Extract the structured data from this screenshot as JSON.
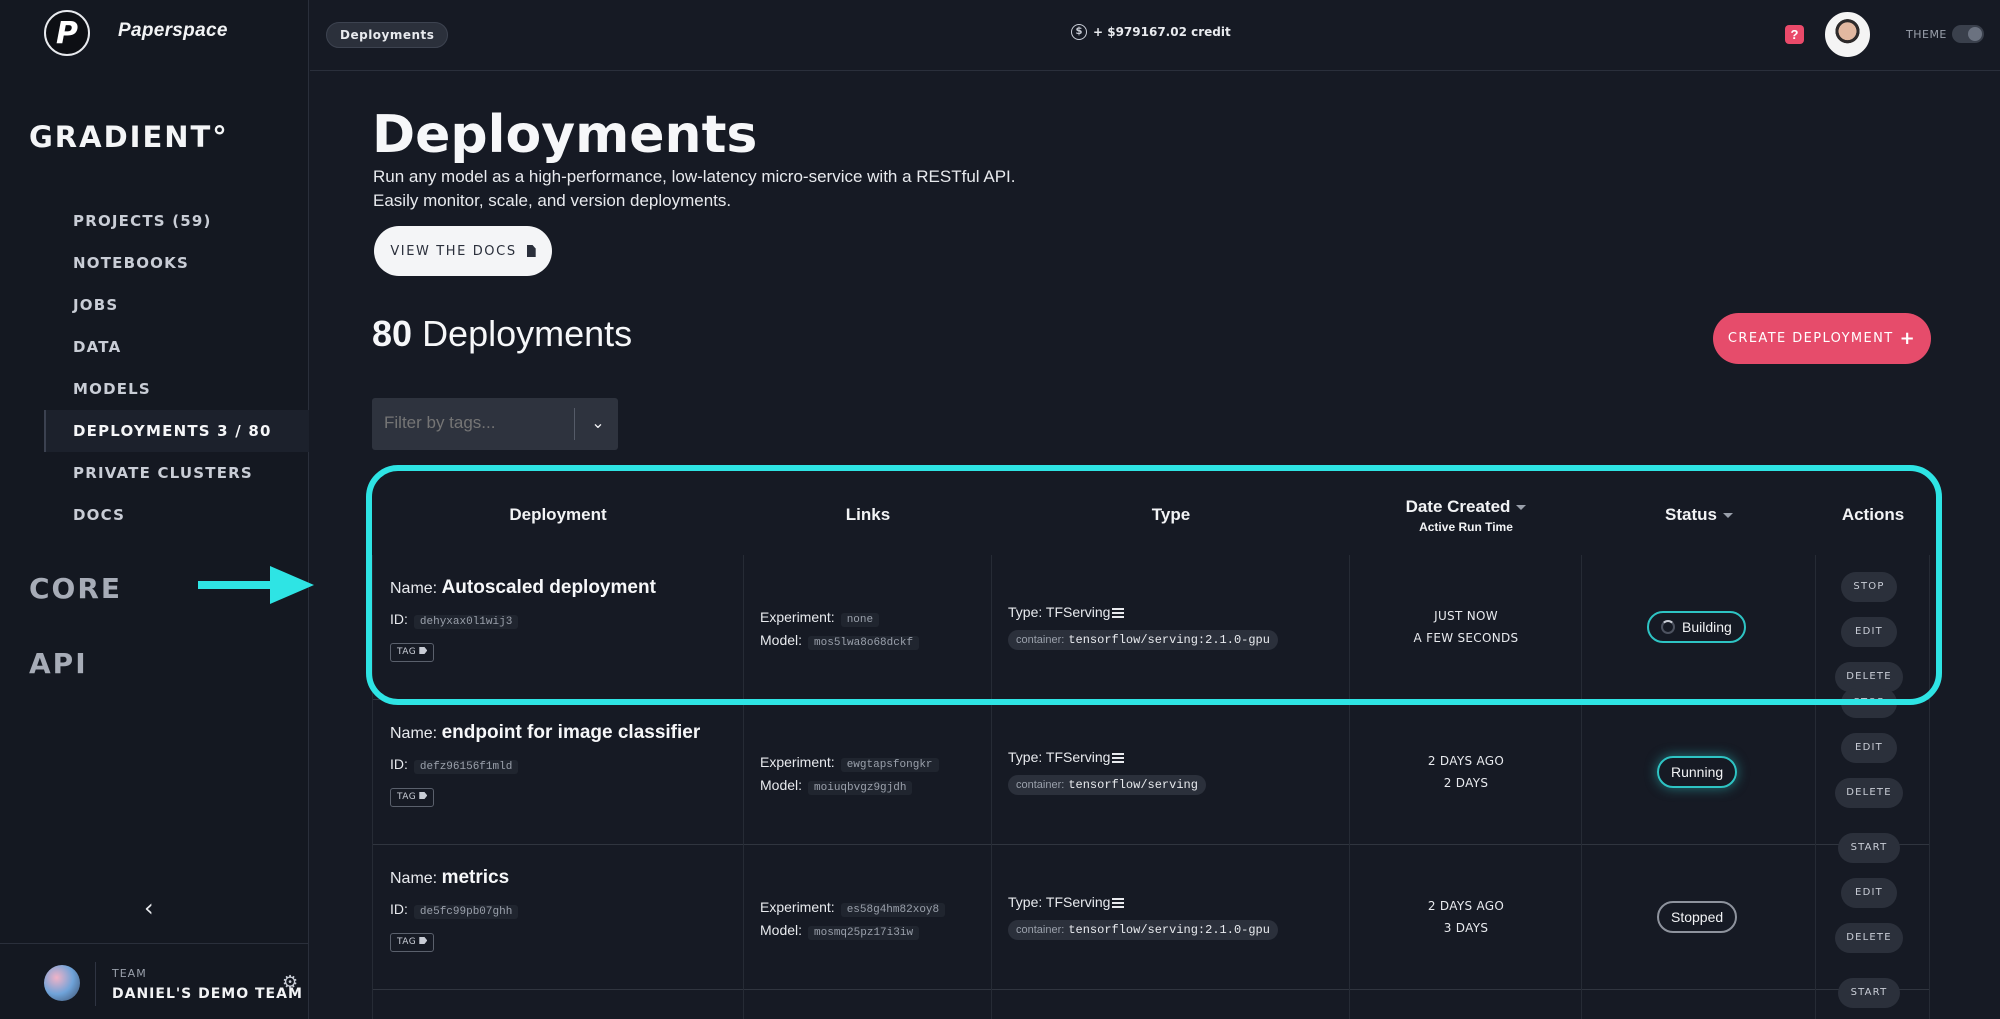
{
  "brand": {
    "logo_letter": "P",
    "name": "Paperspace"
  },
  "sidebar": {
    "product": "GRADIENT°",
    "items": [
      {
        "label": "PROJECTS (59)"
      },
      {
        "label": "NOTEBOOKS"
      },
      {
        "label": "JOBS"
      },
      {
        "label": "DATA"
      },
      {
        "label": "MODELS"
      },
      {
        "label": "DEPLOYMENTS 3 / 80",
        "active": true
      },
      {
        "label": "PRIVATE CLUSTERS"
      },
      {
        "label": "DOCS"
      }
    ],
    "sections": [
      "CORE",
      "API"
    ],
    "collapse_glyph": "‹",
    "team": {
      "label": "TEAM",
      "name": "DANIEL'S DEMO TEAM",
      "settings_glyph": "⚙"
    }
  },
  "topbar": {
    "breadcrumb": "Deployments",
    "credit_icon": "$",
    "credit": "+ $979167.02  credit",
    "help": "?",
    "theme_label": "THEME"
  },
  "main": {
    "title": "Deployments",
    "description_line1": "Run any model as a high-performance, low-latency micro-service with a RESTful API.",
    "description_line2": "Easily monitor, scale, and version deployments.",
    "docs_button": "VIEW THE DOCS",
    "count_number": "80",
    "count_label": "Deployments",
    "create_button": "CREATE DEPLOYMENT",
    "create_plus": "+",
    "filter_placeholder": "Filter by tags...",
    "filter_chevron": "⌄"
  },
  "table": {
    "headers": {
      "deployment": "Deployment",
      "links": "Links",
      "type": "Type",
      "date_created": "Date Created",
      "active_run_time": "Active Run Time",
      "status": "Status",
      "actions": "Actions"
    },
    "labels": {
      "name": "Name:",
      "id": "ID:",
      "tag": "TAG",
      "experiment": "Experiment:",
      "model": "Model:",
      "type": "Type:",
      "container": "container:"
    },
    "rows": [
      {
        "name": "Autoscaled deployment",
        "id": "dehyxax0l1wij3",
        "experiment": "none",
        "model": "mos5lwa8o68dckf",
        "type": "TFServing",
        "container": "tensorflow/serving:2.1.0-gpu",
        "date_created": "JUST NOW",
        "run_time": "A FEW SECONDS",
        "status": "Building",
        "actions": [
          "STOP",
          "EDIT",
          "DELETE"
        ]
      },
      {
        "name": "endpoint for image classifier",
        "id": "defz96156f1mld",
        "experiment": "ewgtapsfongkr",
        "model": "moiuqbvgz9gjdh",
        "type": "TFServing",
        "container": "tensorflow/serving",
        "date_created": "2 DAYS AGO",
        "run_time": "2 DAYS",
        "status": "Running",
        "actions": [
          "STOP",
          "EDIT",
          "DELETE"
        ]
      },
      {
        "name": "metrics",
        "id": "de5fc99pb07ghh",
        "experiment": "es58g4hm82xoy8",
        "model": "mosmq25pz17i3iw",
        "type": "TFServing",
        "container": "tensorflow/serving:2.1.0-gpu",
        "date_created": "2 DAYS AGO",
        "run_time": "3 DAYS",
        "status": "Stopped",
        "actions": [
          "START",
          "EDIT",
          "DELETE"
        ]
      },
      {
        "actions": [
          "START"
        ]
      }
    ]
  },
  "colors": {
    "accent_pink": "#e64c6b",
    "accent_cyan": "#2ee4e4",
    "background": "#161a24"
  }
}
